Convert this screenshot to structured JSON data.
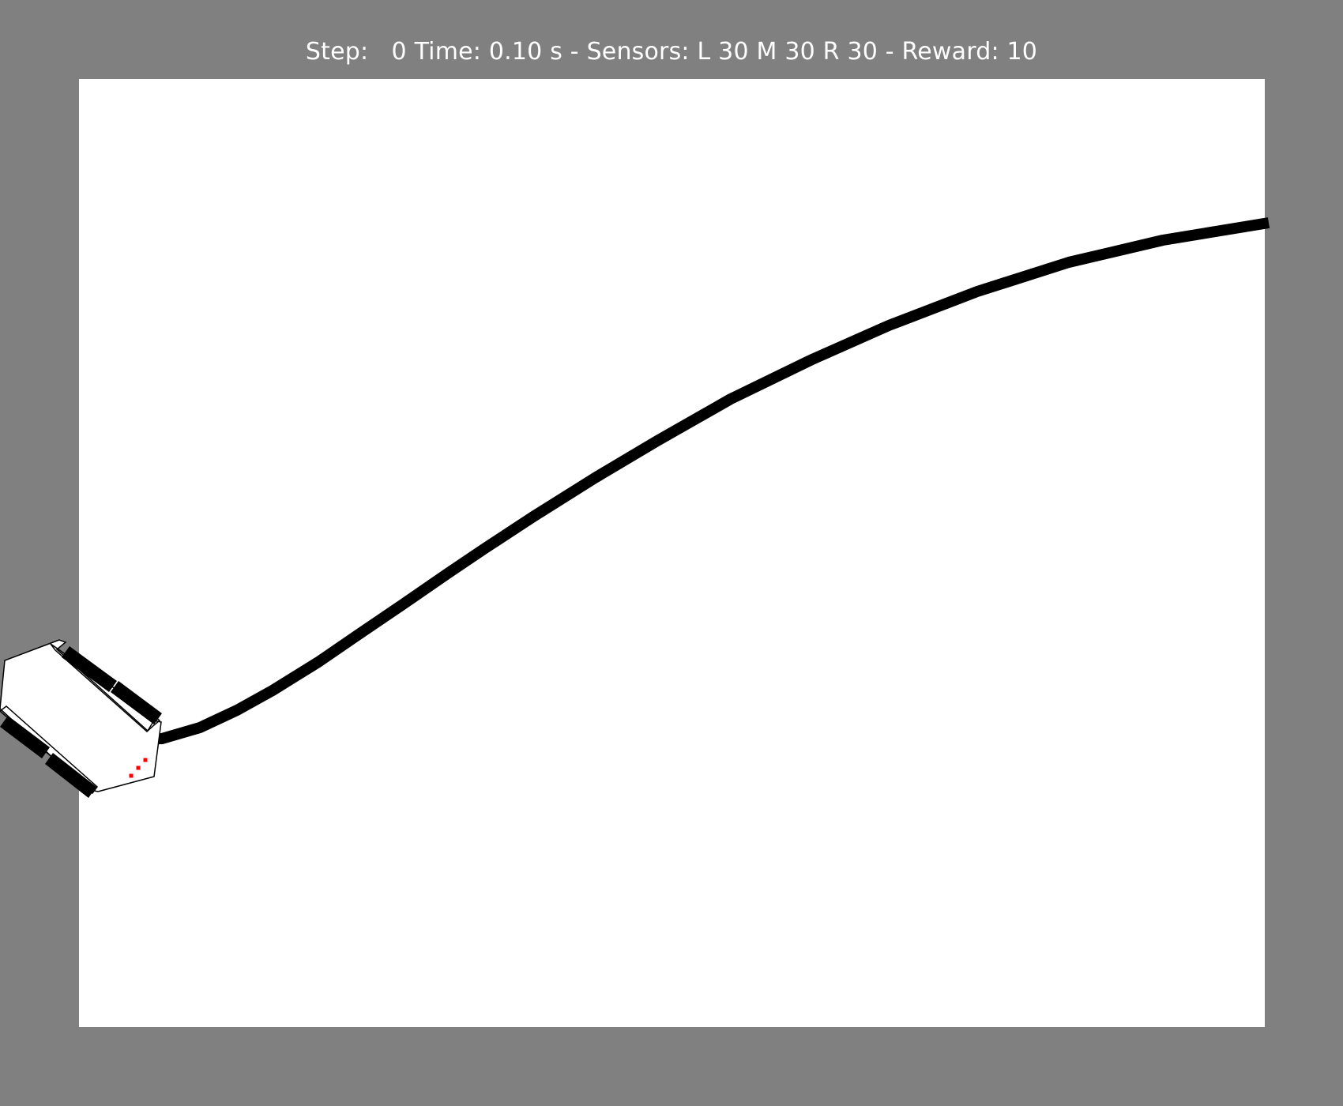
{
  "colors": {
    "background": "#808080",
    "arena": "#ffffff",
    "track": "#000000",
    "robot_outline": "#000000",
    "wheel": "#000000",
    "sensor": "#ff0000",
    "status_text": "#ffffff"
  },
  "status": {
    "step_label": "Step:",
    "step_value": "0",
    "time_label": "Time:",
    "time_value": "0.10",
    "time_unit": "s",
    "sensors_label": "Sensors:",
    "sensor_left_label": "L",
    "sensor_left_value": "30",
    "sensor_middle_label": "M",
    "sensor_middle_value": "30",
    "sensor_right_label": "R",
    "sensor_right_value": "30",
    "reward_label": "Reward:",
    "reward_value": "10"
  },
  "robot": {
    "sensors": [
      "L",
      "M",
      "R"
    ]
  }
}
